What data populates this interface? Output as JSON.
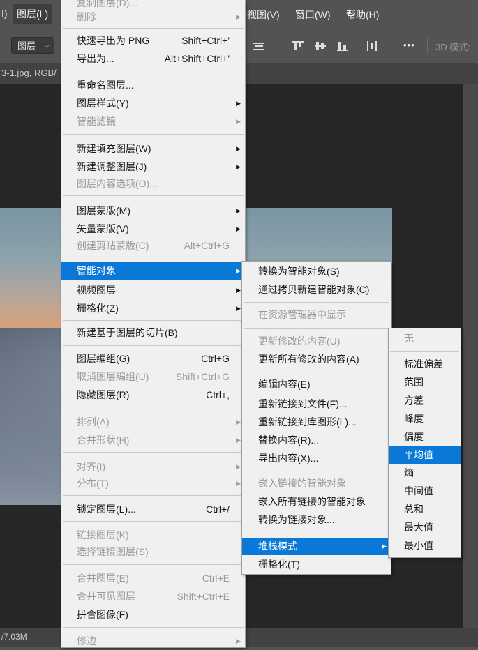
{
  "menubar": {
    "left_fragment": "I)",
    "layer": "图层(L)",
    "view": "视图(V)",
    "window": "窗口(W)",
    "help": "帮助(H)"
  },
  "options": {
    "layer_select": "图层",
    "more": "•••",
    "mode_3d": "3D 模式:"
  },
  "document": {
    "tab_title": "3-1.jpg, RGB/",
    "status": "/7.03M"
  },
  "layer_menu": {
    "items": [
      {
        "label": "删除",
        "shortcut": "",
        "disabled": true,
        "submenu": true
      },
      {
        "label": "快速导出为 PNG",
        "shortcut": "Shift+Ctrl+'",
        "disabled": false,
        "submenu": false
      },
      {
        "label": "导出为...",
        "shortcut": "Alt+Shift+Ctrl+'",
        "disabled": false,
        "submenu": false
      },
      {
        "label": "重命名图层...",
        "shortcut": "",
        "disabled": false,
        "submenu": false
      },
      {
        "label": "图层样式(Y)",
        "shortcut": "",
        "disabled": false,
        "submenu": true
      },
      {
        "label": "智能滤镜",
        "shortcut": "",
        "disabled": true,
        "submenu": true
      },
      {
        "label": "新建填充图层(W)",
        "shortcut": "",
        "disabled": false,
        "submenu": true
      },
      {
        "label": "新建调整图层(J)",
        "shortcut": "",
        "disabled": false,
        "submenu": true
      },
      {
        "label": "图层内容选项(O)...",
        "shortcut": "",
        "disabled": true,
        "submenu": false
      },
      {
        "label": "图层蒙版(M)",
        "shortcut": "",
        "disabled": false,
        "submenu": true
      },
      {
        "label": "矢量蒙版(V)",
        "shortcut": "",
        "disabled": false,
        "submenu": true
      },
      {
        "label": "创建剪贴蒙版(C)",
        "shortcut": "Alt+Ctrl+G",
        "disabled": true,
        "submenu": false
      },
      {
        "label": "智能对象",
        "shortcut": "",
        "disabled": false,
        "submenu": true,
        "highlighted": true
      },
      {
        "label": "视频图层",
        "shortcut": "",
        "disabled": false,
        "submenu": true
      },
      {
        "label": "栅格化(Z)",
        "shortcut": "",
        "disabled": false,
        "submenu": true
      },
      {
        "label": "新建基于图层的切片(B)",
        "shortcut": "",
        "disabled": false,
        "submenu": false
      },
      {
        "label": "图层编组(G)",
        "shortcut": "Ctrl+G",
        "disabled": false,
        "submenu": false
      },
      {
        "label": "取消图层编组(U)",
        "shortcut": "Shift+Ctrl+G",
        "disabled": true,
        "submenu": false
      },
      {
        "label": "隐藏图层(R)",
        "shortcut": "Ctrl+,",
        "disabled": false,
        "submenu": false
      },
      {
        "label": "排列(A)",
        "shortcut": "",
        "disabled": true,
        "submenu": true
      },
      {
        "label": "合并形状(H)",
        "shortcut": "",
        "disabled": true,
        "submenu": true
      },
      {
        "label": "对齐(I)",
        "shortcut": "",
        "disabled": true,
        "submenu": true
      },
      {
        "label": "分布(T)",
        "shortcut": "",
        "disabled": true,
        "submenu": true
      },
      {
        "label": "锁定图层(L)...",
        "shortcut": "Ctrl+/",
        "disabled": false,
        "submenu": false
      },
      {
        "label": "链接图层(K)",
        "shortcut": "",
        "disabled": true,
        "submenu": false
      },
      {
        "label": "选择链接图层(S)",
        "shortcut": "",
        "disabled": true,
        "submenu": false
      },
      {
        "label": "合并图层(E)",
        "shortcut": "Ctrl+E",
        "disabled": true,
        "submenu": false
      },
      {
        "label": "合并可见图层",
        "shortcut": "Shift+Ctrl+E",
        "disabled": true,
        "submenu": false
      },
      {
        "label": "拼合图像(F)",
        "shortcut": "",
        "disabled": false,
        "submenu": false
      },
      {
        "label": "修边",
        "shortcut": "",
        "disabled": true,
        "submenu": true
      }
    ]
  },
  "smart_object_menu": {
    "items": [
      {
        "label": "转换为智能对象(S)",
        "disabled": false
      },
      {
        "label": "通过拷贝新建智能对象(C)",
        "disabled": false
      },
      {
        "label": "在资源管理器中显示",
        "disabled": true
      },
      {
        "label": "更新修改的内容(U)",
        "disabled": true
      },
      {
        "label": "更新所有修改的内容(A)",
        "disabled": false
      },
      {
        "label": "编辑内容(E)",
        "disabled": false
      },
      {
        "label": "重新链接到文件(F)...",
        "disabled": false
      },
      {
        "label": "重新链接到库图形(L)...",
        "disabled": false
      },
      {
        "label": "替换内容(R)...",
        "disabled": false
      },
      {
        "label": "导出内容(X)...",
        "disabled": false
      },
      {
        "label": "嵌入链接的智能对象",
        "disabled": true
      },
      {
        "label": "嵌入所有链接的智能对象",
        "disabled": false
      },
      {
        "label": "转换为链接对象...",
        "disabled": false
      },
      {
        "label": "堆栈模式",
        "disabled": false,
        "highlighted": true,
        "submenu": true
      },
      {
        "label": "栅格化(T)",
        "disabled": false
      }
    ]
  },
  "stack_mode_menu": {
    "items": [
      {
        "label": "无",
        "disabled": true
      },
      {
        "label": "标准偏差",
        "disabled": false
      },
      {
        "label": "范围",
        "disabled": false
      },
      {
        "label": "方差",
        "disabled": false
      },
      {
        "label": "峰度",
        "disabled": false
      },
      {
        "label": "偏度",
        "disabled": false
      },
      {
        "label": "平均值",
        "disabled": false,
        "highlighted": true
      },
      {
        "label": "熵",
        "disabled": false
      },
      {
        "label": "中间值",
        "disabled": false
      },
      {
        "label": "总和",
        "disabled": false
      },
      {
        "label": "最大值",
        "disabled": false
      },
      {
        "label": "最小值",
        "disabled": false
      }
    ]
  },
  "colors": {
    "highlight": "#0a78d7",
    "menu_bg": "#f0f0f0",
    "app_bg": "#535353",
    "canvas_bg": "#262626"
  }
}
